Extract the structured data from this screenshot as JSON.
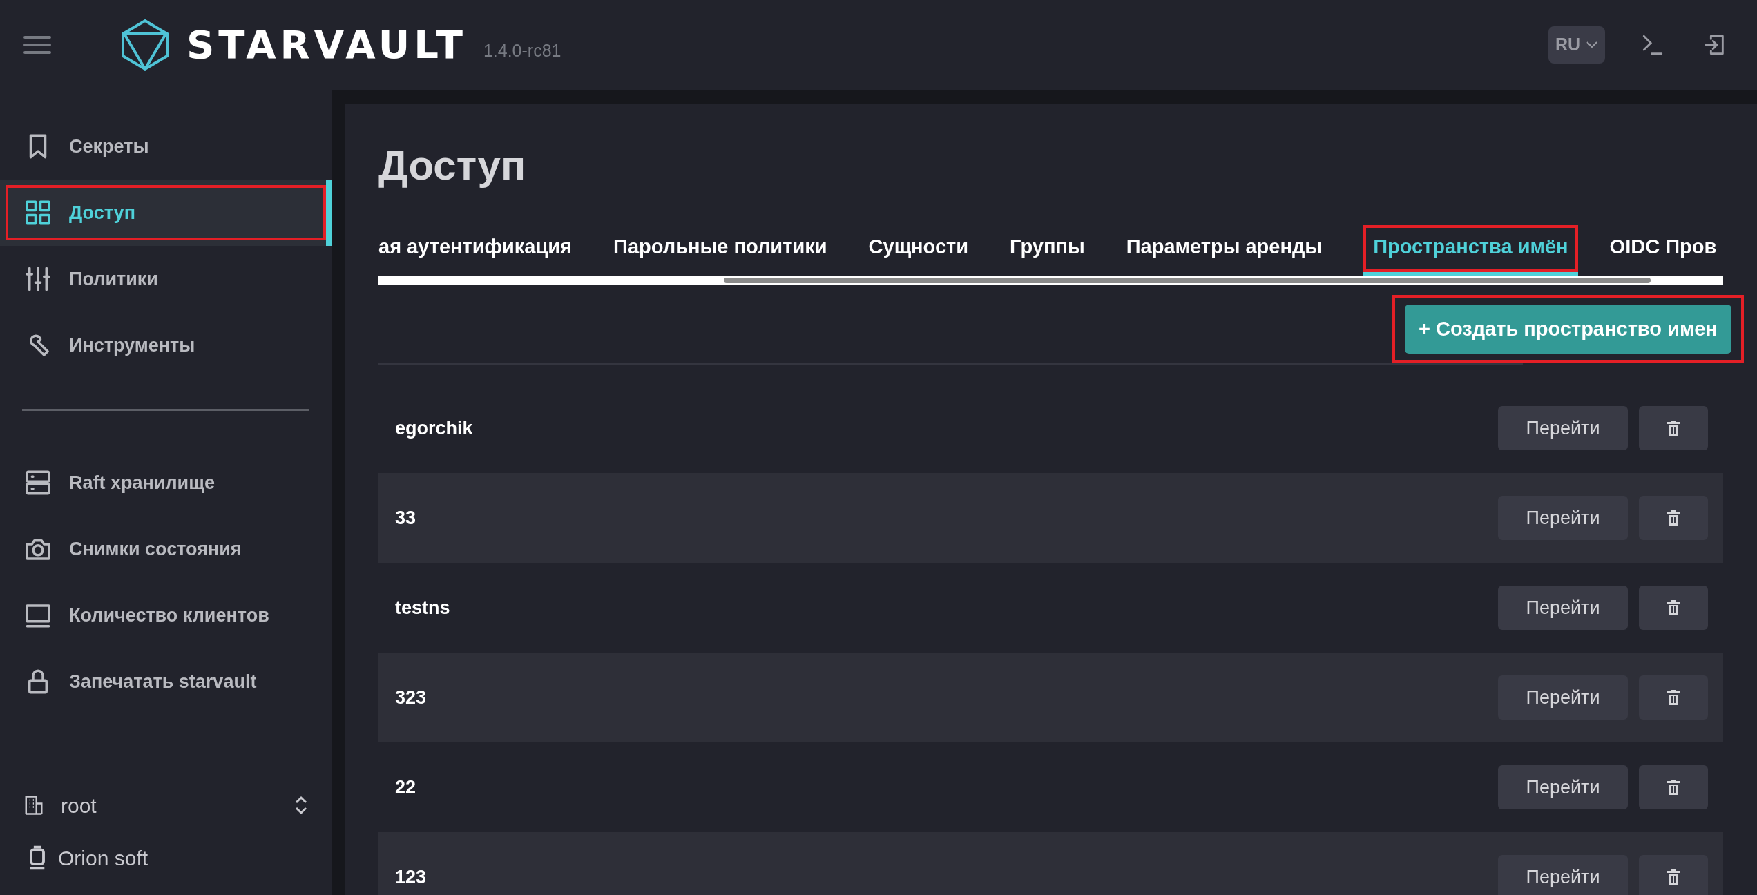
{
  "header": {
    "logo_text": "STARVAULT",
    "version": "1.4.0-rc81",
    "language": "RU"
  },
  "sidebar": {
    "primary_items": [
      {
        "kind": "bookmark",
        "label": "Секреты",
        "selected": false,
        "highlighted": false
      },
      {
        "kind": "grid",
        "label": "Доступ",
        "selected": true,
        "highlighted": true
      },
      {
        "kind": "sliders",
        "label": "Политики",
        "selected": false,
        "highlighted": false
      },
      {
        "kind": "wrench",
        "label": "Инструменты",
        "selected": false,
        "highlighted": false
      }
    ],
    "secondary_items": [
      {
        "kind": "server",
        "label": "Raft хранилище",
        "selected": false,
        "highlighted": false
      },
      {
        "kind": "camera",
        "label": "Снимки состояния",
        "selected": false,
        "highlighted": false
      },
      {
        "kind": "monitor",
        "label": "Количество клиентов",
        "selected": false,
        "highlighted": false
      },
      {
        "kind": "lock",
        "label": "Запечатать starvault",
        "selected": false,
        "highlighted": false
      }
    ],
    "namespace": {
      "label": "root"
    },
    "organization": {
      "label": "Orion soft"
    }
  },
  "page": {
    "title": "Доступ",
    "tabs": [
      {
        "label": "ая аутентификация",
        "selected": false,
        "highlighted": false
      },
      {
        "label": "Парольные политики",
        "selected": false,
        "highlighted": false
      },
      {
        "label": "Сущности",
        "selected": false,
        "highlighted": false
      },
      {
        "label": "Группы",
        "selected": false,
        "highlighted": false
      },
      {
        "label": "Параметры аренды",
        "selected": false,
        "highlighted": false
      },
      {
        "label": "Пространства имён",
        "selected": true,
        "highlighted": true
      },
      {
        "label": "OIDC Пров",
        "selected": false,
        "highlighted": false
      }
    ],
    "create_button": {
      "label": "+ Создать пространство имен",
      "highlighted": true
    },
    "rows": [
      {
        "name": "egorchik",
        "open_label": "Перейти"
      },
      {
        "name": "33",
        "open_label": "Перейти"
      },
      {
        "name": "testns",
        "open_label": "Перейти"
      },
      {
        "name": "323",
        "open_label": "Перейти"
      },
      {
        "name": "22",
        "open_label": "Перейти"
      },
      {
        "name": "123",
        "open_label": "Перейти"
      }
    ]
  }
}
